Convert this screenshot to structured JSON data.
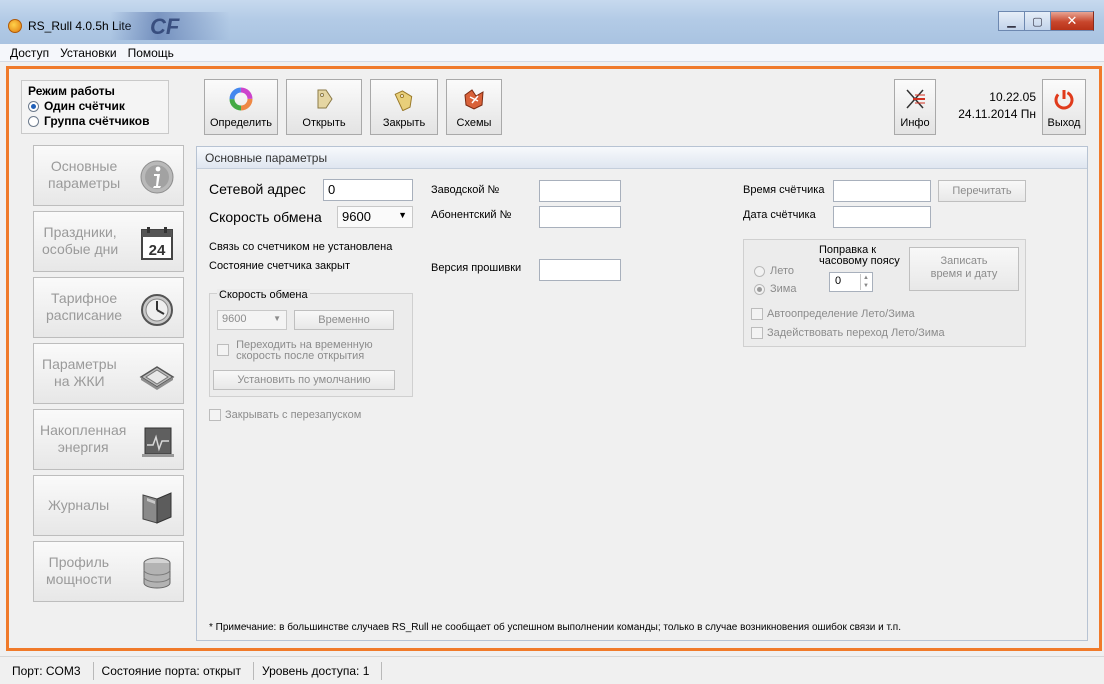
{
  "window": {
    "title": "RS_Rull 4.0.5h Lite",
    "logo_text": "CF"
  },
  "menu": {
    "items": [
      "Доступ",
      "Установки",
      "Помощь"
    ]
  },
  "mode": {
    "title": "Режим работы",
    "options": [
      "Один счётчик",
      "Группа счётчиков"
    ],
    "selected": 0
  },
  "nav": {
    "items": [
      {
        "label_1": "Основные",
        "label_2": "параметры",
        "icon": "info-icon"
      },
      {
        "label_1": "Праздники,",
        "label_2": "особые дни",
        "icon": "calendar-icon",
        "icon_text": "24"
      },
      {
        "label_1": "Тарифное",
        "label_2": "расписание",
        "icon": "clock-icon"
      },
      {
        "label_1": "Параметры",
        "label_2": "на ЖКИ",
        "icon": "display-icon"
      },
      {
        "label_1": "Накопленная",
        "label_2": "энергия",
        "icon": "energy-chart-icon"
      },
      {
        "label_1": "Журналы",
        "label_2": "",
        "icon": "journal-icon"
      },
      {
        "label_1": "Профиль",
        "label_2": "мощности",
        "icon": "database-icon"
      }
    ]
  },
  "toolbar": {
    "detect": "Определить",
    "open": "Открыть",
    "close": "Закрыть",
    "schemes": "Схемы",
    "info": "Инфо",
    "exit": "Выход",
    "time": "10.22.05",
    "date": "24.11.2014 Пн"
  },
  "panel": {
    "title": "Основные параметры",
    "net_address_label": "Сетевой адрес",
    "net_address_value": "0",
    "baud_label": "Скорость обмена",
    "baud_value": "9600",
    "link_status": "Связь со счетчиком  не установлена",
    "meter_state": "Состояние счетчика  закрыт",
    "serial_label": "Заводской №",
    "serial_value": "",
    "subscriber_label": "Абонентский №",
    "subscriber_value": "",
    "firmware_label": "Версия прошивки",
    "firmware_value": "",
    "meter_time_label": "Время счётчика",
    "meter_time_value": "",
    "reread_button": "Перечитать",
    "meter_date_label": "Дата счётчика",
    "meter_date_value": "",
    "speed_group": {
      "title": "Скорость обмена",
      "value": "9600",
      "temp_button": "Временно",
      "switch_label_1": "Переходить на временную",
      "switch_label_2": "скорость после открытия",
      "default_button": "Установить по умолчанию"
    },
    "close_restart": "Закрывать с перезапуском",
    "tz_group": {
      "summer": "Лето",
      "winter": "Зима",
      "selected": "winter",
      "tz_label_1": "Поправка к",
      "tz_label_2": "часовому поясу",
      "tz_value": "0",
      "write_button_1": "Записать",
      "write_button_2": "время и дату",
      "auto_dst": "Автоопределение Лето/Зима",
      "enable_dst": "Задействовать переход Лето/Зима"
    },
    "note": "* Примечание: в большинстве случаев RS_Rull не сообщает об успешном выполнении команды; только в случае возникновения ошибок связи и т.п."
  },
  "status": {
    "port": "Порт: COM3",
    "port_state": "Состояние порта: открыт",
    "access": "Уровень доступа: 1"
  },
  "colors": {
    "frame_accent": "#f07a2a",
    "exit_icon": "#e03b1c"
  }
}
